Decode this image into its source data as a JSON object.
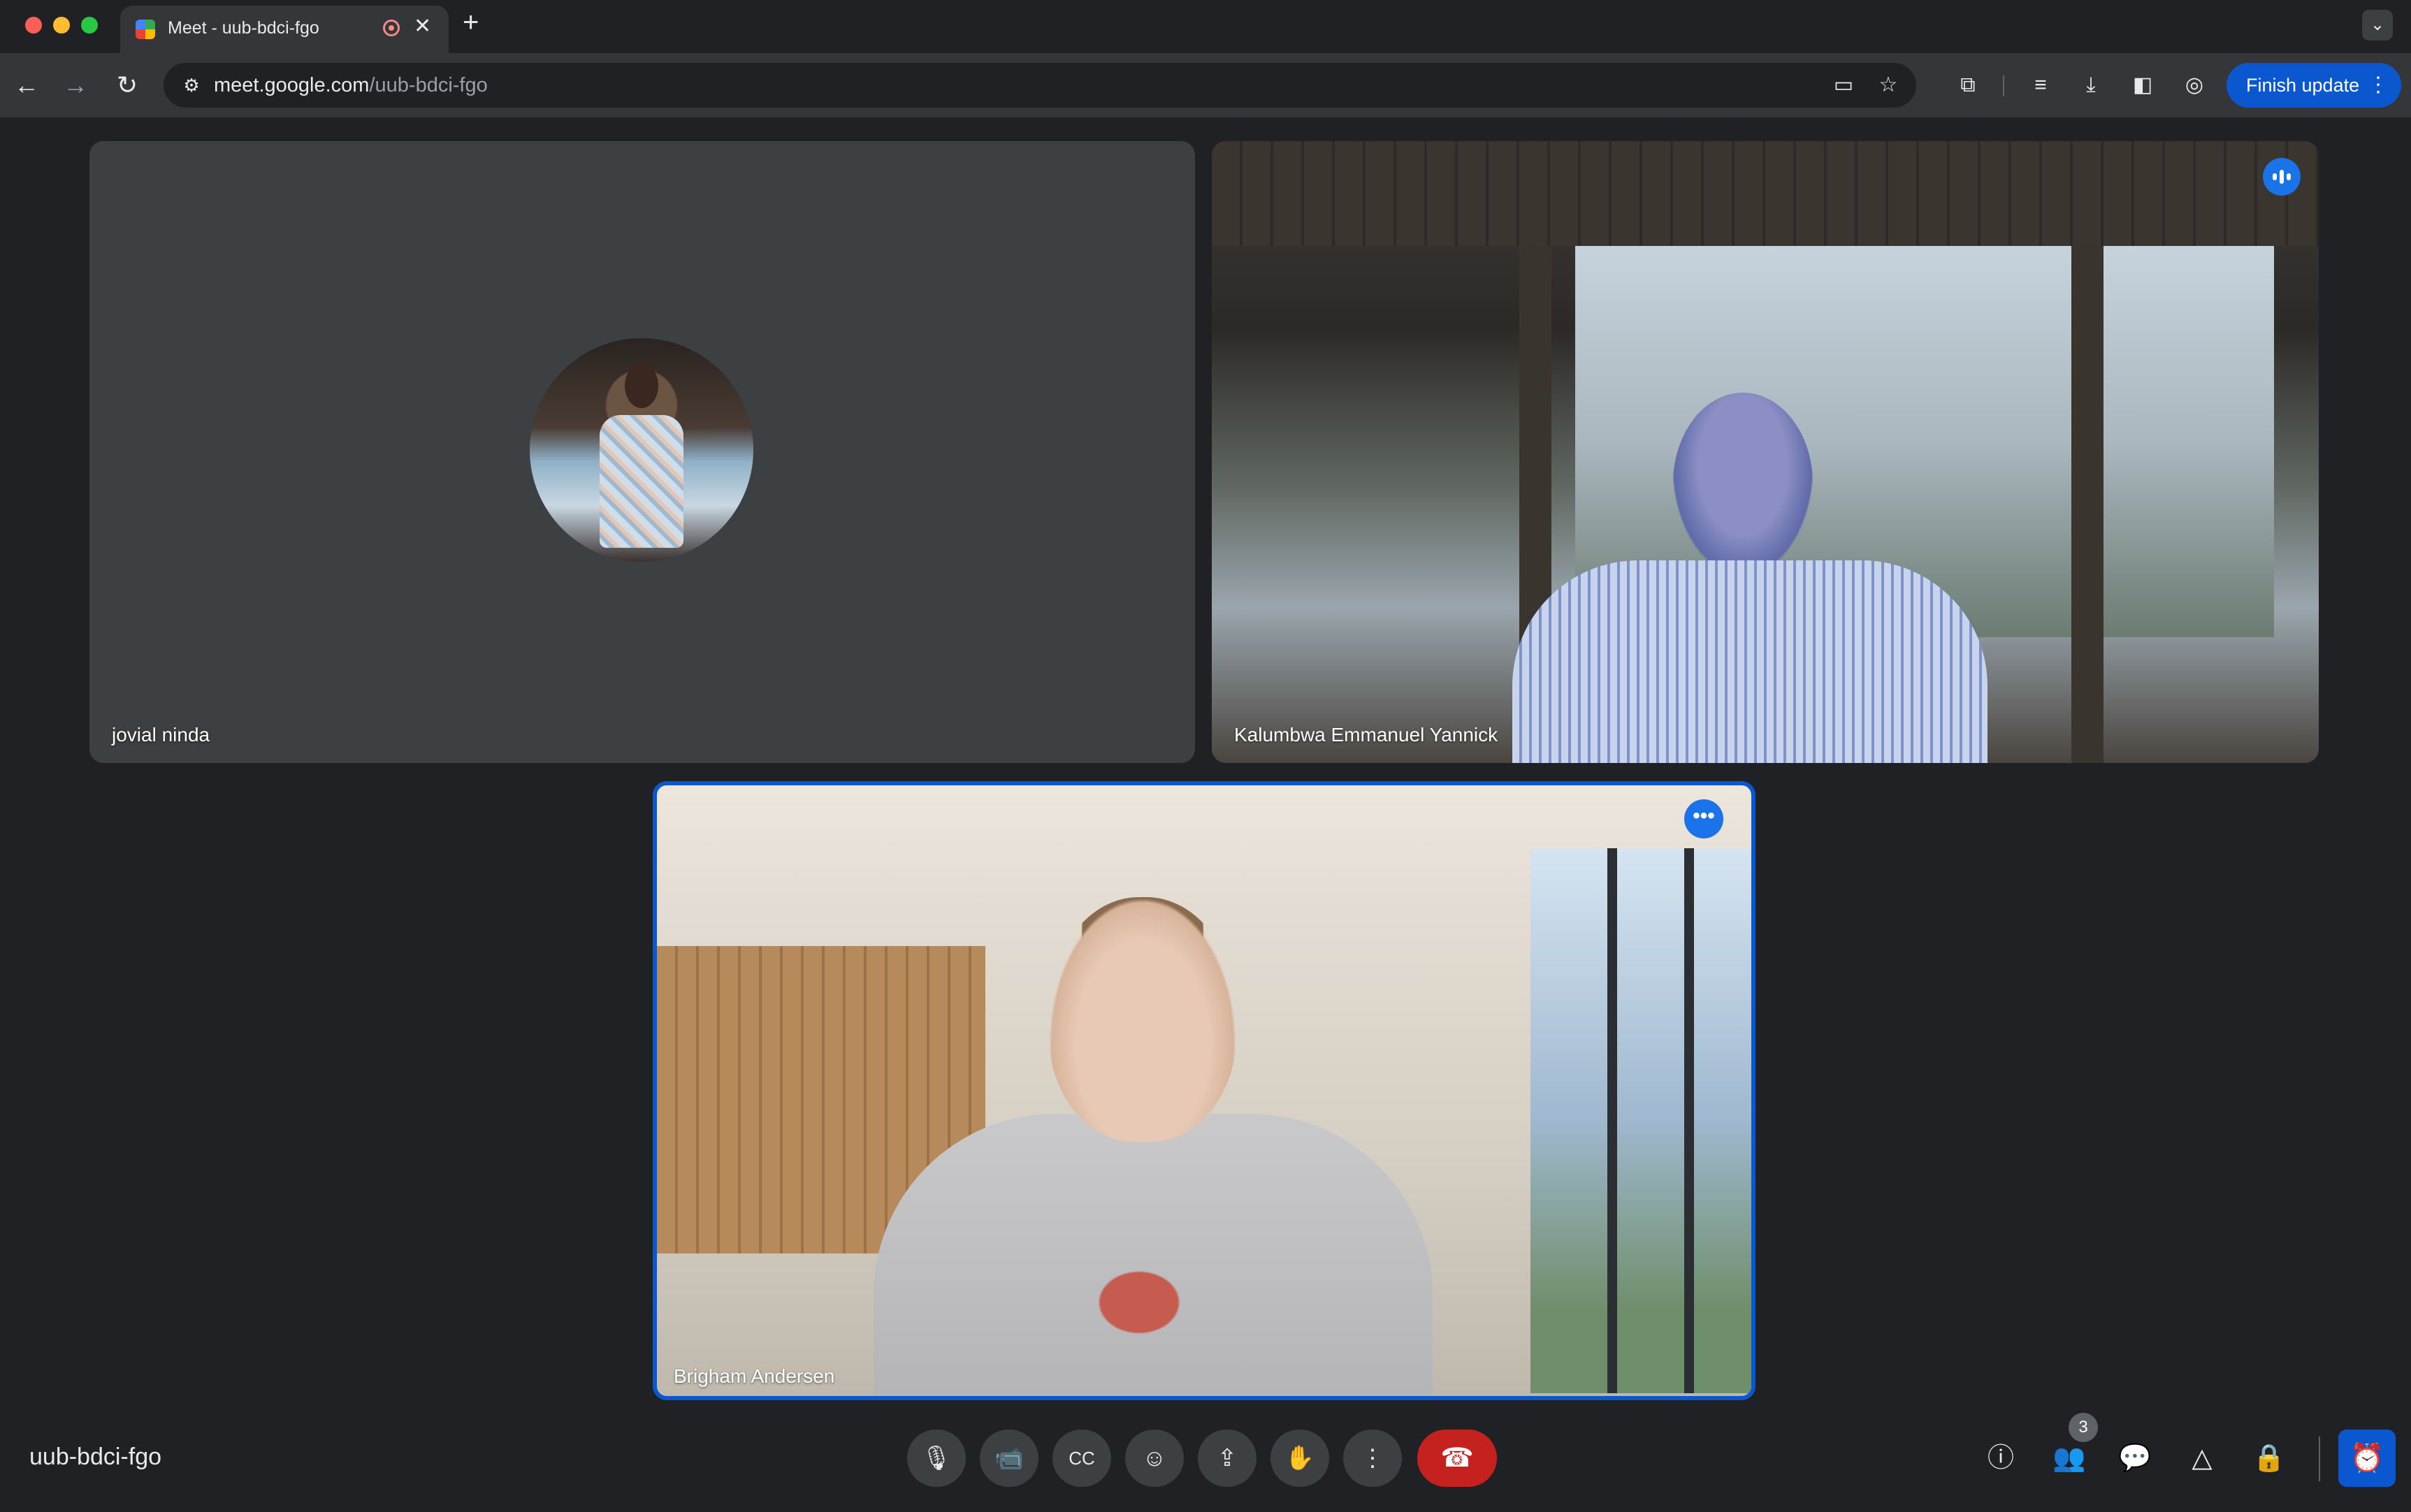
{
  "browser": {
    "tab_title": "Meet - uub-bdci-fgo",
    "tab_close": "✕",
    "new_tab": "+",
    "tab_search": "⌄",
    "url_host": "meet.google.com",
    "url_path": "/uub-bdci-fgo",
    "finish_update_label": "Finish update",
    "finish_update_menu": "⋮"
  },
  "icons": {
    "back": "←",
    "forward": "→",
    "reload": "↻",
    "site_settings": "⚙",
    "camera": "▭",
    "bookmark": "☆",
    "extensions": "⧉",
    "media": "≡",
    "download": "⤓",
    "side_panel": "◧",
    "incognito": "◎"
  },
  "participants": [
    {
      "name": "jovial ninda"
    },
    {
      "name": "Kalumbwa Emmanuel Yannick"
    },
    {
      "name": "Brigham Andersen"
    }
  ],
  "tile_menu": "•••",
  "meeting": {
    "code": "uub-bdci-fgo",
    "people_count": "3"
  },
  "controls": {
    "mic": "🎙",
    "camera": "📹",
    "captions": "CC",
    "reactions": "☺",
    "present": "⇪",
    "raise_hand": "✋",
    "more": "⋮",
    "leave": "☎"
  },
  "side_controls": {
    "info": "ⓘ",
    "people": "👥",
    "chat": "💬",
    "activities": "△",
    "host_controls": "🔒",
    "timer": "⏰"
  },
  "colors": {
    "accent": "#0b57d0",
    "leave": "#c5221f",
    "background": "#202124"
  }
}
